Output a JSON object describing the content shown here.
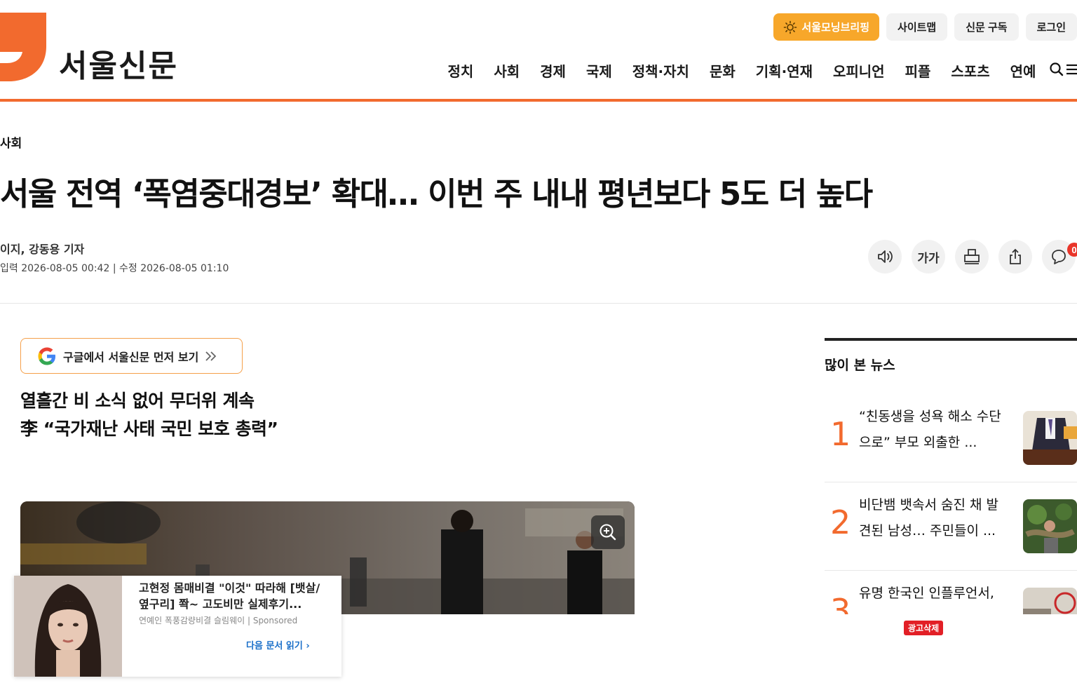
{
  "site": {
    "logo_text": "서울신문",
    "brand_color": "#f26a2e",
    "logo_mark_color": "#f26a2e"
  },
  "utility": {
    "briefing_label": "서울모닝브리핑",
    "briefing_icon": "sun-icon",
    "briefing_color": "#f7a72a",
    "sitemap_label": "사이트맵",
    "subscribe_label": "신문 구독",
    "login_label": "로그인"
  },
  "nav": {
    "items": [
      "정치",
      "사회",
      "경제",
      "국제",
      "정책·자치",
      "문화",
      "기획·연재",
      "오피니언",
      "피플",
      "스포츠",
      "연예"
    ],
    "search_icon": "search-icon",
    "menu_icon": "menu-icon"
  },
  "article": {
    "section": "사회",
    "headline": "서울 전역 ‘폭염중대경보’ 확대… 이번 주 내내 평년보다 5도 더 높다",
    "byline": "이지, 강동용 기자",
    "dates": "입력 2026-08-05 00:42 | 수정 2026-08-05 01:10",
    "google_follow_label": "구글에서 서울신문 먼저 보기",
    "subheads": [
      "열흘간 비 소식 없어 무더위 계속",
      "李 “국가재난 사태 국민 보호 총력”"
    ],
    "comment_count": "0"
  },
  "tools": {
    "audio_icon": "speaker-icon",
    "font_size_label": "가가",
    "print_icon": "print-icon",
    "share_icon": "share-icon",
    "comment_icon": "comment-icon"
  },
  "ad": {
    "title": "고현정 몸매비결 \"이것\" 따라해 [뱃살/옆구리] 쫙~ 고도비만 실제후기...",
    "source": "연예인 폭풍감량비결 슬림웨이 | Sponsored",
    "next_label": "다음 문서 읽기"
  },
  "sidebar": {
    "title": "많이 본 뉴스",
    "items": [
      {
        "rank": "1",
        "text": "“친동생을 성욕 해소 수단으로” 부모 외출한 ..."
      },
      {
        "rank": "2",
        "text": "비단뱀 뱃속서 숨진 채 발견된 남성… 주민들이 ..."
      },
      {
        "rank": "3",
        "text": "유명 한국인 인플루언서,"
      }
    ],
    "ad_remove_label": "광고삭제"
  }
}
